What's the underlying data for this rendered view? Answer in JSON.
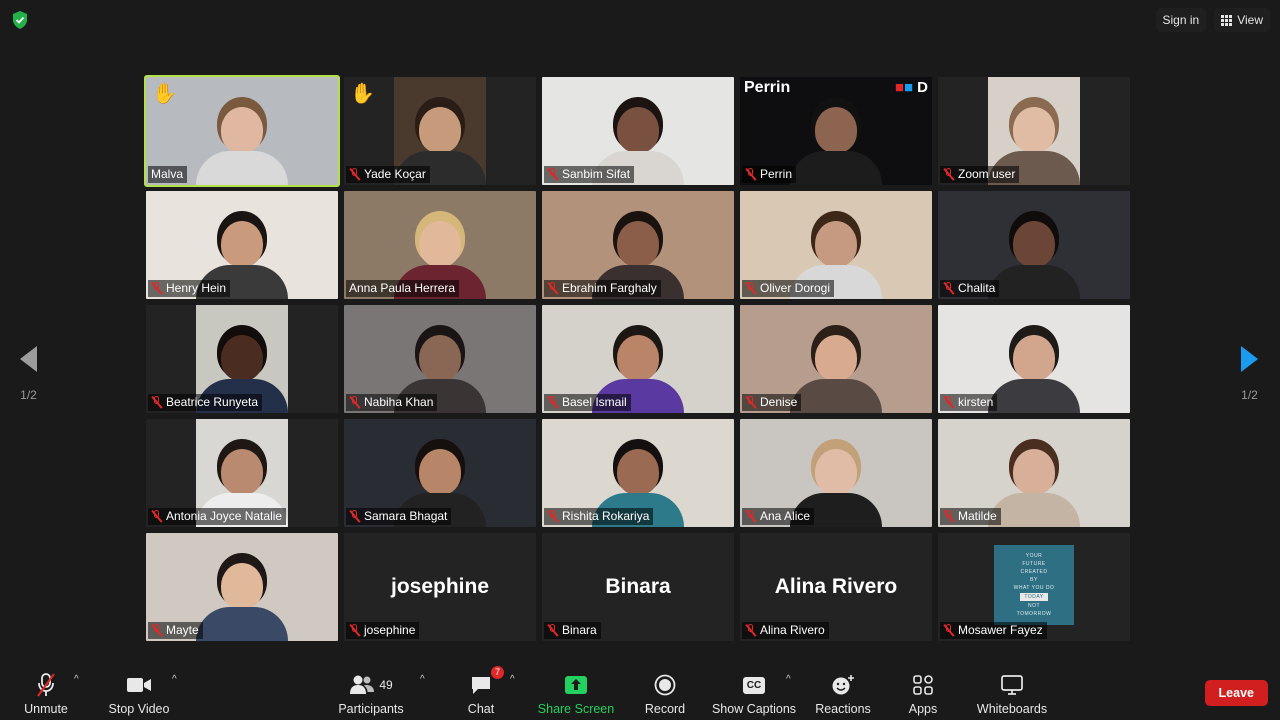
{
  "top": {
    "sign_in": "Sign in",
    "view": "View"
  },
  "tiles": [
    {
      "name": "Malva",
      "muted": false,
      "hand": true,
      "active": true,
      "kind": "video",
      "bg": "#b7bbc0",
      "skin": "#e0b7a1",
      "hair": "#7a5a3f",
      "shirt": "#d9d9d9"
    },
    {
      "name": "Yade Koçar",
      "muted": true,
      "hand": true,
      "kind": "pillar",
      "bg": "#4a3a2e",
      "skin": "#c79a7c",
      "hair": "#2a1d16",
      "shirt": "#2c2c2c"
    },
    {
      "name": "Sanbim Sifat",
      "muted": true,
      "kind": "video",
      "bg": "#e5e5e3",
      "skin": "#7a5140",
      "hair": "#1b1410",
      "shirt": "#d9d6d2"
    },
    {
      "name": "Perrin",
      "muted": true,
      "kind": "perrin",
      "bg": "#0e0e10",
      "skin": "#8d6450",
      "hair": "#111",
      "shirt": "#1c1c1c",
      "title": "Perrin"
    },
    {
      "name": "Zoom user",
      "muted": true,
      "kind": "pillar",
      "bg": "#d6d0c8",
      "skin": "#e0bca4",
      "hair": "#8a6a50",
      "shirt": "#6b5a4d"
    },
    {
      "name": "Henry Hein",
      "muted": true,
      "kind": "video",
      "bg": "#e8e4dd",
      "skin": "#c99b7c",
      "hair": "#1a1512",
      "shirt": "#3a3a3a"
    },
    {
      "name": "Anna Paula Herrera",
      "muted": false,
      "kind": "video",
      "bg": "#8c7a66",
      "skin": "#e2b89a",
      "hair": "#d6b77a",
      "shirt": "#6b2430"
    },
    {
      "name": "Ebrahim Farghaly",
      "muted": true,
      "kind": "video",
      "bg": "#b2927a",
      "skin": "#8a5e48",
      "hair": "#1a120e",
      "shirt": "#3a3030"
    },
    {
      "name": "Oliver Dorogi",
      "muted": true,
      "kind": "video",
      "bg": "#d8c8b4",
      "skin": "#c69a80",
      "hair": "#3d2818",
      "shirt": "#d8d8d8"
    },
    {
      "name": "Chalita",
      "muted": true,
      "kind": "video",
      "bg": "#2f3036",
      "skin": "#6b4636",
      "hair": "#0f0c0b",
      "shirt": "#222"
    },
    {
      "name": "Beatrice Runyeta",
      "muted": true,
      "kind": "pillar",
      "bg": "#c8c8c0",
      "skin": "#4b2c20",
      "hair": "#120c0a",
      "shirt": "#24304a"
    },
    {
      "name": "Nabiha Khan",
      "muted": true,
      "kind": "video",
      "bg": "#7b7676",
      "skin": "#8a6655",
      "hair": "#1a1414",
      "shirt": "#3a3434"
    },
    {
      "name": "Basel Ismail",
      "muted": true,
      "kind": "video",
      "bg": "#d5d2cc",
      "skin": "#b98468",
      "hair": "#1d1714",
      "shirt": "#5a3aa0"
    },
    {
      "name": "Denise",
      "muted": true,
      "kind": "video",
      "bg": "#b79d8e",
      "skin": "#d8aa90",
      "hair": "#2b1f18",
      "shirt": "#5a4a44"
    },
    {
      "name": "kirsten",
      "muted": true,
      "kind": "video",
      "bg": "#e6e4e2",
      "skin": "#d2a68c",
      "hair": "#1d1a18",
      "shirt": "#3c3c40"
    },
    {
      "name": "Antonia Joyce Natalie",
      "muted": true,
      "kind": "pillar",
      "bg": "#d9d7d3",
      "skin": "#b98a70",
      "hair": "#1e1714",
      "shirt": "#ededed"
    },
    {
      "name": "Samara Bhagat",
      "muted": true,
      "kind": "video",
      "bg": "#2a2c34",
      "skin": "#b78669",
      "hair": "#15100e",
      "shirt": "#222"
    },
    {
      "name": "Rishita Rokariya",
      "muted": true,
      "kind": "video",
      "bg": "#dcd8d0",
      "skin": "#9a6a52",
      "hair": "#141010",
      "shirt": "#2c7a8a"
    },
    {
      "name": "Ana Alice",
      "muted": true,
      "kind": "video",
      "bg": "#c9c6c2",
      "skin": "#e0bca6",
      "hair": "#c2a07a",
      "shirt": "#1e1e1e"
    },
    {
      "name": "Matilde",
      "muted": true,
      "kind": "video",
      "bg": "#d6d2cc",
      "skin": "#d8b09a",
      "hair": "#4a2e20",
      "shirt": "#c4b4a4"
    },
    {
      "name": "Mayte",
      "muted": true,
      "kind": "video",
      "bg": "#cfc9c1",
      "skin": "#e0b89a",
      "hair": "#1e1816",
      "shirt": "#3a4a66"
    },
    {
      "name": "josephine",
      "muted": true,
      "kind": "name",
      "display": "josephine"
    },
    {
      "name": "Binara",
      "muted": true,
      "kind": "name",
      "display": "Binara"
    },
    {
      "name": "Alina Rivero",
      "muted": true,
      "kind": "name",
      "display": "Alina Rivero"
    },
    {
      "name": "Mosawer Fayez",
      "muted": true,
      "kind": "poster",
      "poster": [
        "YOUR",
        "FUTURE",
        "CREATED",
        "BY",
        "WHAT YOU DO",
        "TODAY",
        "NOT",
        "TOMORROW"
      ]
    }
  ],
  "pager": {
    "left": "1/2",
    "right": "1/2"
  },
  "toolbar": {
    "unmute": "Unmute",
    "stop_video": "Stop Video",
    "participants": "Participants",
    "participants_count": "49",
    "chat": "Chat",
    "chat_badge": "7",
    "share_screen": "Share Screen",
    "record": "Record",
    "show_captions": "Show Captions",
    "cc": "CC",
    "reactions": "Reactions",
    "apps": "Apps",
    "whiteboards": "Whiteboards",
    "leave": "Leave"
  },
  "colors": {
    "accent_green": "#23d160",
    "active_outline": "#b4e04a",
    "leave_red": "#d11f1f",
    "pager_blue": "#1a9bf0"
  }
}
